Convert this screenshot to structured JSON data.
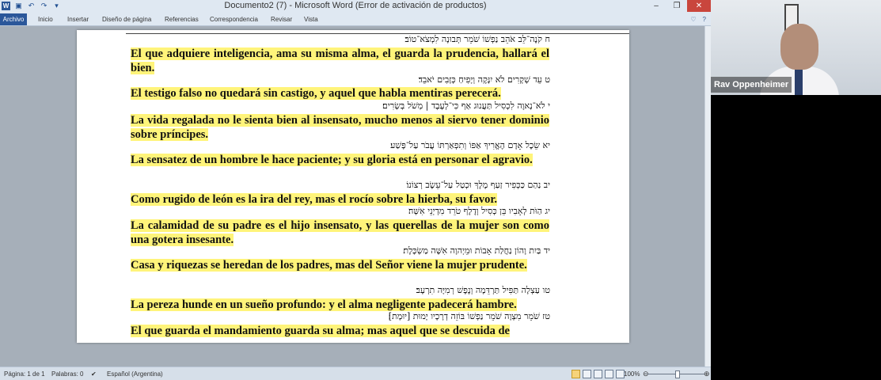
{
  "app": {
    "title": "Documento2 (7)  -  Microsoft Word (Error de activación de productos)",
    "qat_icons": [
      "word-logo",
      "save-icon",
      "undo-icon",
      "redo-icon",
      "customize-icon"
    ]
  },
  "ribbon": {
    "tabs": [
      "Archivo",
      "Inicio",
      "Insertar",
      "Diseño de página",
      "Referencias",
      "Correspondencia",
      "Revisar",
      "Vista"
    ]
  },
  "window_buttons": [
    "–",
    "❐",
    "✕"
  ],
  "document": {
    "verses": [
      {
        "hebrew": "ח קֹנֶה־לֵּב אֹהֵב נַפְשׁוֹ שֹׁמֵר תְּבוּנָה לִמְצֹא־טוֹב׃",
        "spanish": "El que adquiere inteligencia, ama su misma alma, el guarda la prudencia, hallará  el bien."
      },
      {
        "hebrew": "ט עֵד שְׁקָרִים לֹא יִנָּקֶה וְיָפִיחַ כְּזָבִים יֹאבֵד׃",
        "spanish": "El testigo falso no quedará sin castigo, y aquel que habla mentiras perecerá."
      },
      {
        "hebrew": "י לֹא־נָאוֶה לִכְסִיל תַּעֲנוּג אַף כִּי־לְעֶבֶד | מְשֹׁל בְּשָׂרִים׃",
        "spanish": "La vida regalada no le sienta bien al insensato, mucho menos al siervo tener dominio sobre príncipes."
      },
      {
        "hebrew": "יא שֵׂכֶל אָדָם הֶאֱרִיךְ אַפּוֹ וְתִפְאַרְתּוֹ עֲבֹר עַל־פָּשַׁע׃",
        "spanish": "La sensatez de un hombre le hace paciente; y su gloria está en personar el agravio."
      },
      {
        "hebrew": "יב נַהַם כַּכְּפִיר זַעַף מֶלֶךְ וּכְטַל עַל־עֵשֶׂב רְצוֹנוֹ׃",
        "spanish": "Como rugido  de león es la ira del rey, mas el rocío sobre la hierba,  su favor."
      },
      {
        "hebrew": "יג הַוֹּת לְאָבִיו בֵּן כְּסִיל וְדֶלֶף טֹרֵד מִדְיְנֵי אִשָּׁה׃",
        "spanish": "La calamidad de su padre es el hijo insensato, y las querellas de la mujer son como una gotera insesante."
      },
      {
        "hebrew": "יד בַּיִת וָהוֹן נַחֲלַת אָבוֹת וּמֵיְהוָה אִשָּׁה מַשְׂכָּלֶת׃",
        "spanish": "Casa y riquezas se heredan de los padres, mas del Señor viene la mujer prudente."
      },
      {
        "hebrew": "טו עַצְלָה תַּפִּיל תַּרְדֵּמָה וְנֶפֶשׁ רְמִיָּה תִרְעָב׃",
        "spanish": "La pereza hunde  en un sueño profundo:  y el alma negligente padecerá hambre."
      },
      {
        "hebrew": "טז שֹׁמֵר מִצְוָה שֹׁמֵר נַפְשׁוֹ בּוֹזֵה דְרָכָיו יָמוּת [יוּמָת]׃",
        "spanish": "El que guarda el mandamiento guarda su alma; mas aquel que se descuida de"
      }
    ]
  },
  "status_bar": {
    "page": "Página: 1 de 1",
    "words": "Palabras: 0",
    "language": "Español (Argentina)",
    "zoom": "100%",
    "zoom_level": 100
  },
  "video": {
    "name": "Rav Oppenheimer"
  }
}
